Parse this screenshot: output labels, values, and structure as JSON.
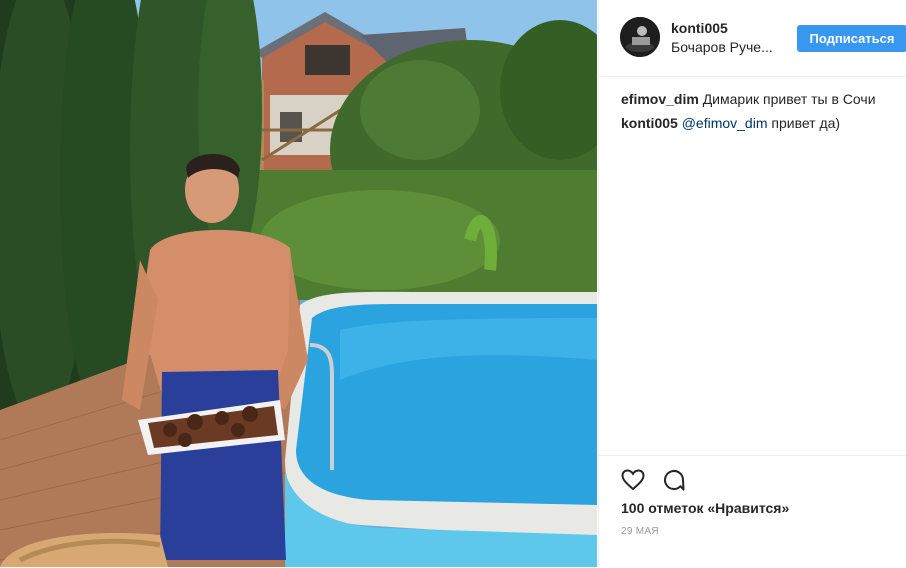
{
  "post": {
    "username": "konti005",
    "location": "Бочаров Руче...",
    "follow_label": "Подписаться"
  },
  "comments": [
    {
      "user": "efimov_dim",
      "mention": "",
      "text": "Димарик привет ты в Сочи"
    },
    {
      "user": "konti005",
      "mention": "@efimov_dim",
      "text": "привет да)"
    }
  ],
  "likes_text": "100 отметок «Нравится»",
  "date_text": "29 МАЯ",
  "icons": {
    "like": "heart-icon",
    "comment": "comment-icon"
  },
  "colors": {
    "follow_button": "#3897f0",
    "mention": "#003569",
    "date": "#999999"
  }
}
